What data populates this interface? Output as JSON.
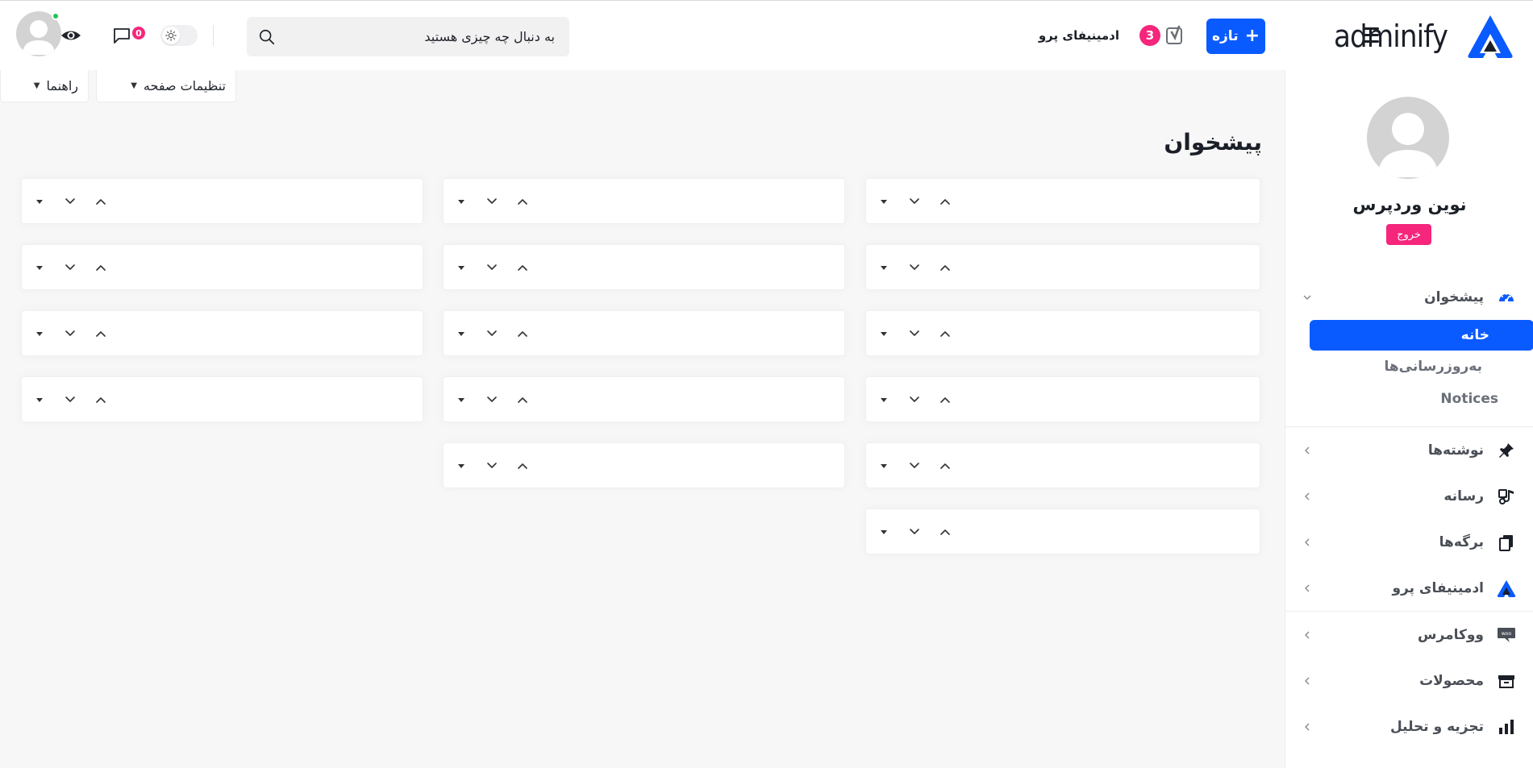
{
  "brand": {
    "name": "adminify",
    "accent": "#0a5bff",
    "pink": "#f5267b"
  },
  "topbar": {
    "new_label": "تازه",
    "pro_label": "ادمینیفای پرو",
    "pro_badge": "3",
    "search_placeholder": "به دنبال چه چیزی هستید",
    "comments_count": "0",
    "icons": [
      "hamburger-icon",
      "yoast-icon",
      "search-icon",
      "sun-icon",
      "comment-icon",
      "eye-icon"
    ]
  },
  "screen_tabs": {
    "screen_options": "تنظیمات صفحه",
    "help": "راهنما"
  },
  "page": {
    "title": "پیشخوان"
  },
  "widget_columns": [
    {
      "count": 6
    },
    {
      "count": 5
    },
    {
      "count": 4
    }
  ],
  "sidebar": {
    "user_name": "نوین وردپرس",
    "logout_label": "خروج",
    "dashboard": {
      "label": "پیشخوان",
      "subitems": [
        {
          "label": "خانه",
          "active": true
        },
        {
          "label": "به‌روزرسانی‌ها",
          "active": false
        },
        {
          "label": "Notices",
          "active": false
        }
      ]
    },
    "items": [
      {
        "label": "نوشته‌ها",
        "icon": "pin-icon"
      },
      {
        "label": "رسانه",
        "icon": "media-icon"
      },
      {
        "label": "برگه‌ها",
        "icon": "pages-icon"
      },
      {
        "label": "ادمینیفای پرو",
        "icon": "adminify-icon"
      },
      {
        "label": "ووکامرس",
        "icon": "woo-icon"
      },
      {
        "label": "محصولات",
        "icon": "archive-icon"
      },
      {
        "label": "تجزیه و تحلیل",
        "icon": "bar-chart-icon"
      }
    ]
  }
}
